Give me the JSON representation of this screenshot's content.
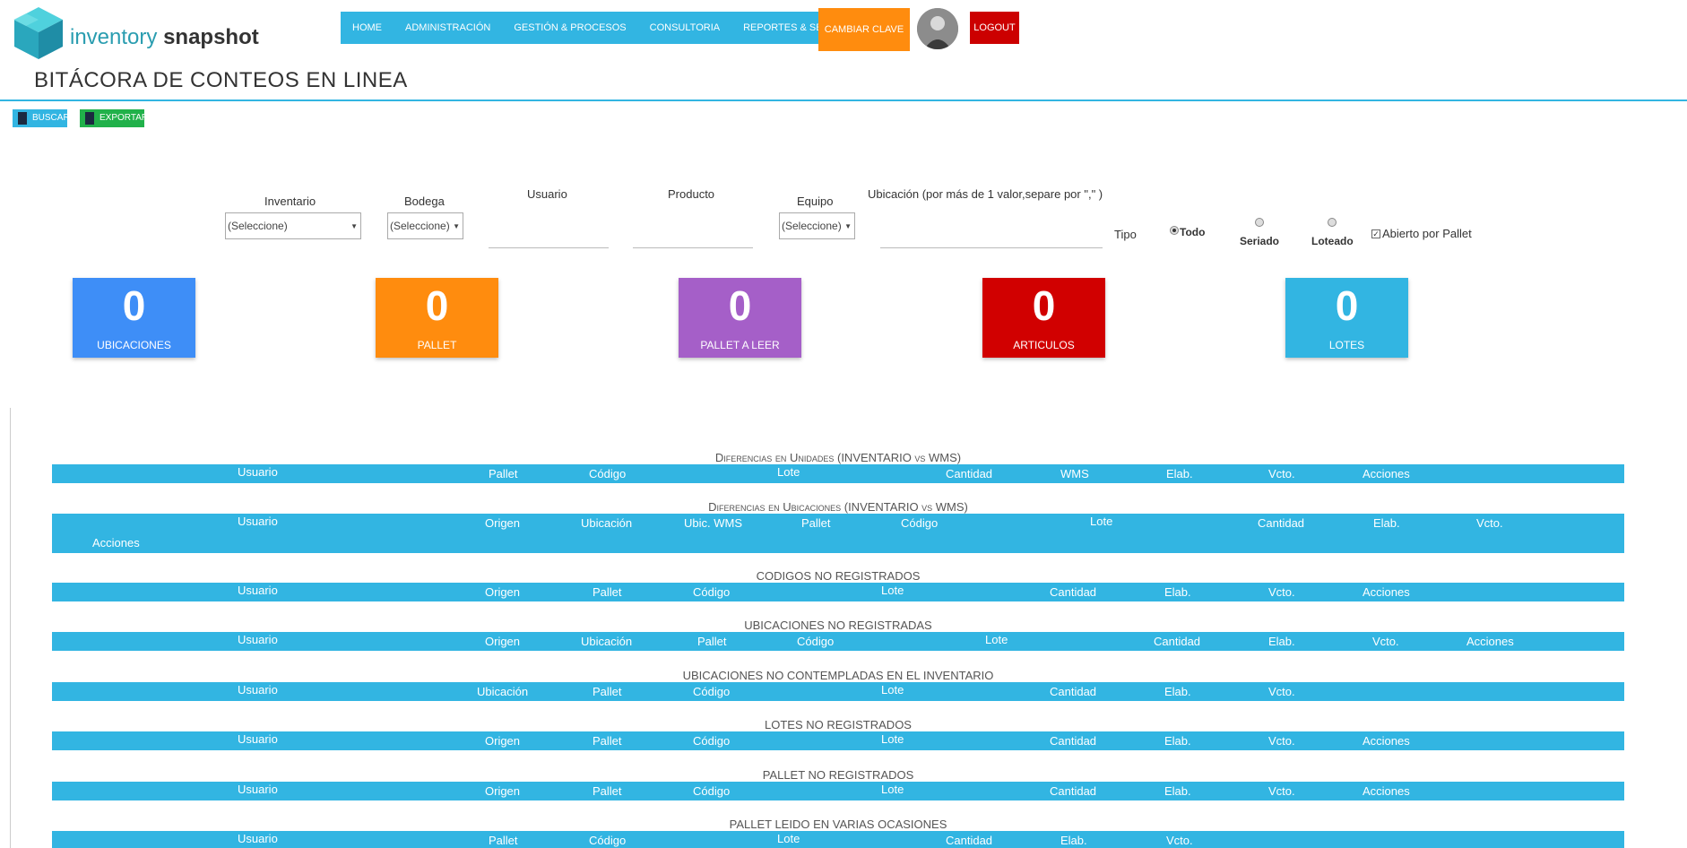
{
  "brand": {
    "logo_light": "inventory",
    "logo_bold": "snapshot"
  },
  "page": {
    "title": "BITÁCORA DE CONTEOS EN LINEA"
  },
  "nav": {
    "items": [
      "HOME",
      "ADMINISTRACIÓN",
      "GESTIÓN & PROCESOS",
      "CONSULTORIA",
      "REPORTES & SERVICIOS"
    ],
    "cambiar_clave": "CAMBIAR CLAVE",
    "logout": "LOGOUT"
  },
  "actions": {
    "buscar": "BUSCAR",
    "exportar": "EXPORTAR"
  },
  "filters": {
    "inventario": {
      "label": "Inventario",
      "value": "(Seleccione)"
    },
    "bodega": {
      "label": "Bodega",
      "value": "(Seleccione)"
    },
    "usuario": {
      "label": "Usuario"
    },
    "producto": {
      "label": "Producto"
    },
    "equipo": {
      "label": "Equipo",
      "value": "(Seleccione)"
    },
    "ubicacion": {
      "label": "Ubicación (por más de 1 valor,separe por \",\" )"
    },
    "tipo": {
      "label": "Tipo",
      "options": [
        "Todo",
        "Seriado",
        "Loteado"
      ],
      "selected": "Todo"
    },
    "abierto": {
      "label": "Abierto por Pallet",
      "checked": true
    }
  },
  "cards": [
    {
      "value": "0",
      "label": "UBICACIONES",
      "color": "#3e8ef7"
    },
    {
      "value": "0",
      "label": "PALLET",
      "color": "#ff8c0e"
    },
    {
      "value": "0",
      "label": "PALLET A LEER",
      "color": "#a55fc8"
    },
    {
      "value": "0",
      "label": "ARTICULOS",
      "color": "#d10000"
    },
    {
      "value": "0",
      "label": "LOTES",
      "color": "#32b5e2"
    }
  ],
  "sections": {
    "s1": {
      "title": "Diferencias en Unidades (INVENTARIO vs WMS)",
      "cols": [
        "Usuario",
        "Pallet",
        "Código",
        "Lote",
        "Cantidad",
        "WMS",
        "Elab.",
        "Vcto.",
        "Acciones"
      ]
    },
    "s2": {
      "title": "Diferencias en Ubicaciones (INVENTARIO vs WMS)",
      "cols": [
        "Usuario",
        "Origen",
        "Ubicación",
        "Ubic. WMS",
        "Pallet",
        "Código",
        "Lote",
        "Cantidad",
        "Elab.",
        "Vcto.",
        "Acciones"
      ]
    },
    "s3": {
      "title": "CODIGOS NO REGISTRADOS",
      "cols": [
        "Usuario",
        "Origen",
        "Pallet",
        "Código",
        "Lote",
        "Cantidad",
        "Elab.",
        "Vcto.",
        "Acciones"
      ]
    },
    "s4": {
      "title": "UBICACIONES NO REGISTRADAS",
      "cols": [
        "Usuario",
        "Origen",
        "Ubicación",
        "Pallet",
        "Código",
        "Lote",
        "Cantidad",
        "Elab.",
        "Vcto.",
        "Acciones"
      ]
    },
    "s5": {
      "title": "UBICACIONES NO CONTEMPLADAS EN EL INVENTARIO",
      "cols": [
        "Usuario",
        "Ubicación",
        "Pallet",
        "Código",
        "Lote",
        "Cantidad",
        "Elab.",
        "Vcto."
      ]
    },
    "s6": {
      "title": "LOTES NO REGISTRADOS",
      "cols": [
        "Usuario",
        "Origen",
        "Pallet",
        "Código",
        "Lote",
        "Cantidad",
        "Elab.",
        "Vcto.",
        "Acciones"
      ]
    },
    "s7": {
      "title": "PALLET NO REGISTRADOS",
      "cols": [
        "Usuario",
        "Origen",
        "Pallet",
        "Código",
        "Lote",
        "Cantidad",
        "Elab.",
        "Vcto.",
        "Acciones"
      ]
    },
    "s8": {
      "title": "PALLET LEIDO EN VARIAS OCASIONES",
      "cols": [
        "Usuario",
        "Pallet",
        "Código",
        "Lote",
        "Cantidad",
        "Elab.",
        "Vcto."
      ]
    }
  }
}
